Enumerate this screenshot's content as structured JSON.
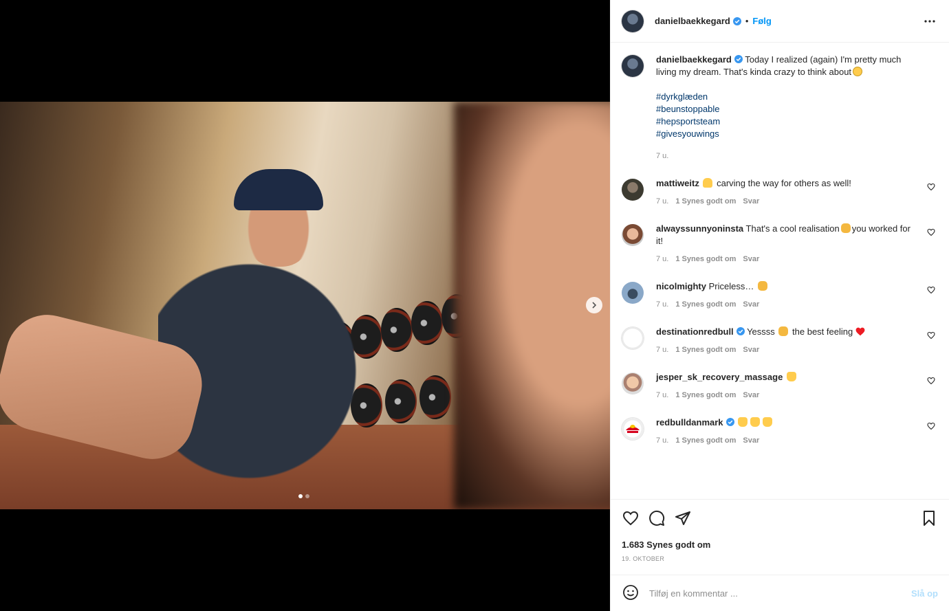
{
  "post": {
    "username": "danielbaekkegard",
    "follow_label": "Følg",
    "separator": "•",
    "caption": "Today I realized (again) I'm pretty much living my dream. That's kinda crazy to think about",
    "hashtags": [
      "#dyrkglæden",
      "#beunstoppable",
      "#hepsportsteam",
      "#givesyouwings"
    ],
    "caption_age": "7 u."
  },
  "comments": [
    {
      "user": "mattiweitz",
      "emoji_before": "muscle",
      "text": "carving the way for others as well!",
      "age": "7 u.",
      "likes": "1 Synes godt om",
      "reply": "Svar",
      "verified": false
    },
    {
      "user": "alwayssunnyoninsta",
      "text": "That's a cool realisation",
      "emoji_mid": "clap",
      "text2": "you worked for it!",
      "age": "7 u.",
      "likes": "1 Synes godt om",
      "reply": "Svar",
      "verified": false
    },
    {
      "user": "nicolmighty",
      "text": "Priceless…",
      "emoji_after": "clap",
      "age": "7 u.",
      "likes": "1 Synes godt om",
      "reply": "Svar",
      "verified": false
    },
    {
      "user": "destinationredbull",
      "text": "Yessss",
      "emoji_mid": "clap",
      "text2": "the best feeling",
      "emoji_end": "heart",
      "age": "7 u.",
      "likes": "1 Synes godt om",
      "reply": "Svar",
      "verified": true
    },
    {
      "user": "jesper_sk_recovery_massage",
      "emoji_after": "raise",
      "age": "7 u.",
      "likes": "1 Synes godt om",
      "reply": "Svar",
      "verified": false
    },
    {
      "user": "redbulldanmark",
      "emoji_after": "raise3",
      "age": "7 u.",
      "likes": "1 Synes godt om",
      "reply": "Svar",
      "verified": true
    }
  ],
  "stats": {
    "likes": "1.683 Synes godt om",
    "date": "19. OKTOBER"
  },
  "add_comment": {
    "placeholder": "Tilføj en kommentar ...",
    "post_label": "Slå op"
  },
  "carousel": {
    "slides": 2,
    "active": 1
  },
  "colors": {
    "link": "#00376b",
    "accent": "#0095f6",
    "verified": "#3897f0",
    "muted": "#8e8e8e"
  }
}
